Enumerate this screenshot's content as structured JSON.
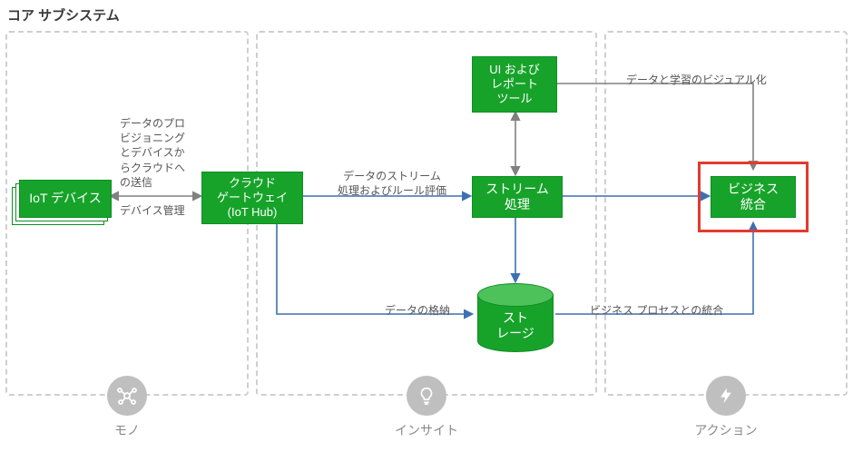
{
  "title": "コア サブシステム",
  "zones": {
    "things": {
      "label": "モノ"
    },
    "insight": {
      "label": "インサイト"
    },
    "action": {
      "label": "アクション"
    }
  },
  "nodes": {
    "iot_devices": "IoT デバイス",
    "cloud_gateway_l1": "クラウド",
    "cloud_gateway_l2": "ゲートウェイ",
    "cloud_gateway_l3": "(IoT Hub)",
    "ui_report_l1": "UI および",
    "ui_report_l2": "レポート",
    "ui_report_l3": "ツール",
    "stream_proc_l1": "ストリーム",
    "stream_proc_l2": "処理",
    "storage_l1": "スト",
    "storage_l2": "レージ",
    "biz_integ_l1": "ビジネス",
    "biz_integ_l2": "統合"
  },
  "edges": {
    "dev_to_gw_l1": "データのプロ",
    "dev_to_gw_l2": "ビジョニング",
    "dev_to_gw_l3": "とデバイスか",
    "dev_to_gw_l4": "らクラウドへ",
    "dev_to_gw_l5": "の送信",
    "dev_mgmt": "デバイス管理",
    "gw_to_stream_l1": "データのストリーム",
    "gw_to_stream_l2": "処理およびルール評価",
    "data_store": "データの格納",
    "biz_process": "ビジネス プロセスとの統合",
    "viz": "データと学習のビジュアル化"
  },
  "colors": {
    "node": "#17a32a",
    "highlight": "#e23b2e",
    "arrow_grey": "#808080",
    "arrow_blue": "#3d6fb4"
  }
}
